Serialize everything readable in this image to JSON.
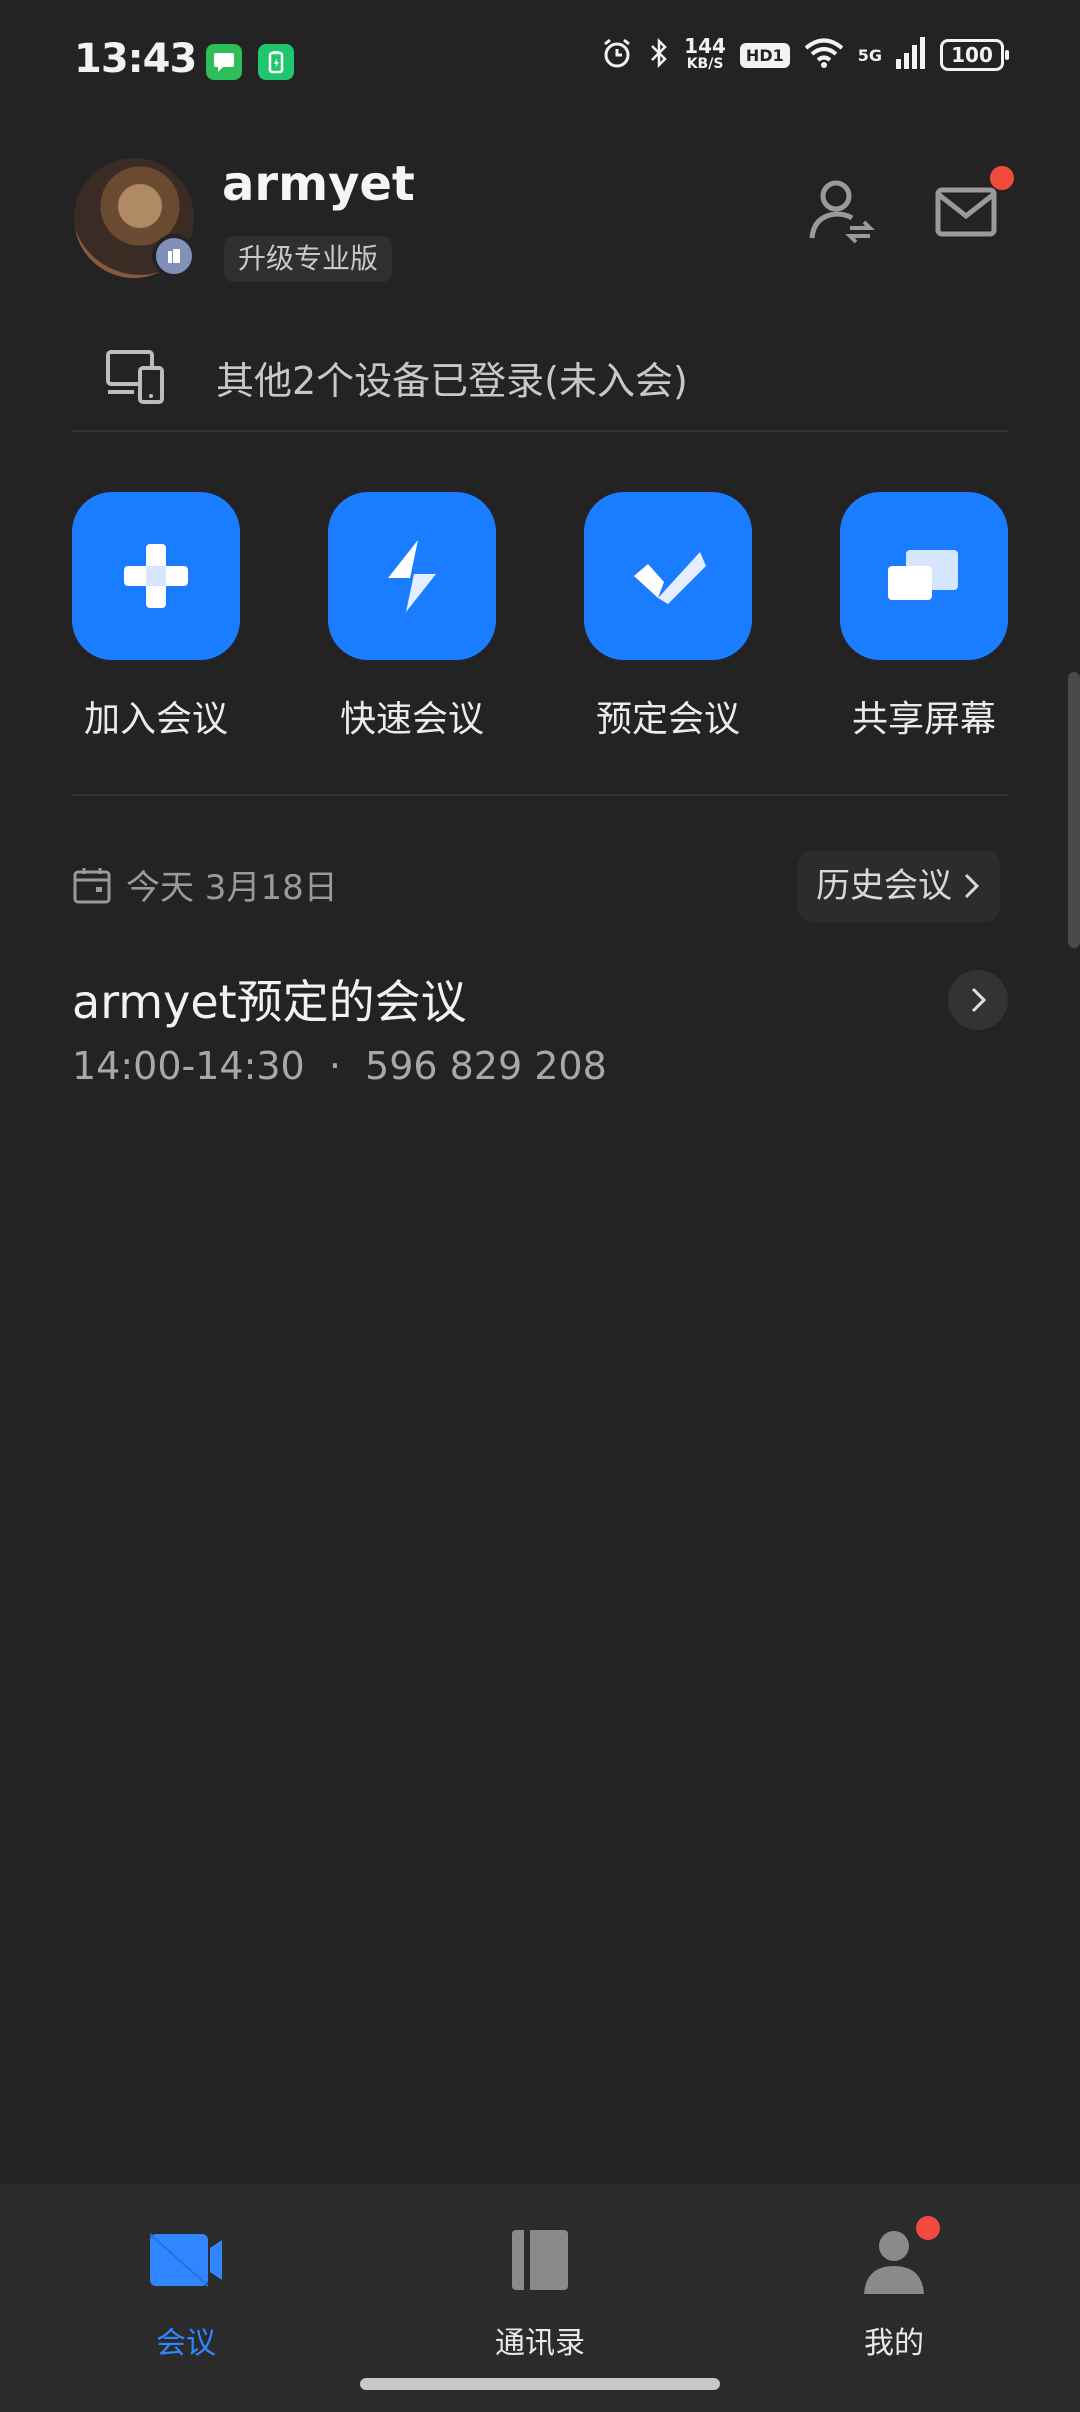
{
  "status_bar": {
    "time": "13:43",
    "net_speed": "144",
    "net_unit": "KB/S",
    "hd": "HD1",
    "network": "5G",
    "battery": "100",
    "icons": [
      "message-icon",
      "battery-app-icon",
      "alarm-icon",
      "bluetooth-icon",
      "wifi-icon",
      "signal-icon"
    ]
  },
  "header": {
    "username": "armyet",
    "upgrade_label": "升级专业版",
    "icons": [
      "switch-account-icon",
      "mail-icon"
    ],
    "colors": {
      "notification_dot": "#f04a3c"
    }
  },
  "devices": {
    "text": "其他2个设备已登录(未入会)"
  },
  "actions": [
    {
      "label": "加入会议",
      "icon": "plus-icon"
    },
    {
      "label": "快速会议",
      "icon": "lightning-icon"
    },
    {
      "label": "预定会议",
      "icon": "check-icon"
    },
    {
      "label": "共享屏幕",
      "icon": "share-screen-icon"
    }
  ],
  "schedule": {
    "today_label": "今天 3月18日",
    "history_label": "历史会议",
    "meetings": [
      {
        "title": "armyet预定的会议",
        "time": "14:00-14:30",
        "separator": "·",
        "id": "596 829 208"
      }
    ]
  },
  "bottom_nav": [
    {
      "label": "会议",
      "icon": "meeting-icon",
      "active": true
    },
    {
      "label": "通讯录",
      "icon": "contacts-book-icon",
      "active": false
    },
    {
      "label": "我的",
      "icon": "profile-icon",
      "active": false
    }
  ],
  "colors": {
    "accent": "#1a7cff",
    "background": "#232323",
    "nav_active": "#2f86ff"
  }
}
